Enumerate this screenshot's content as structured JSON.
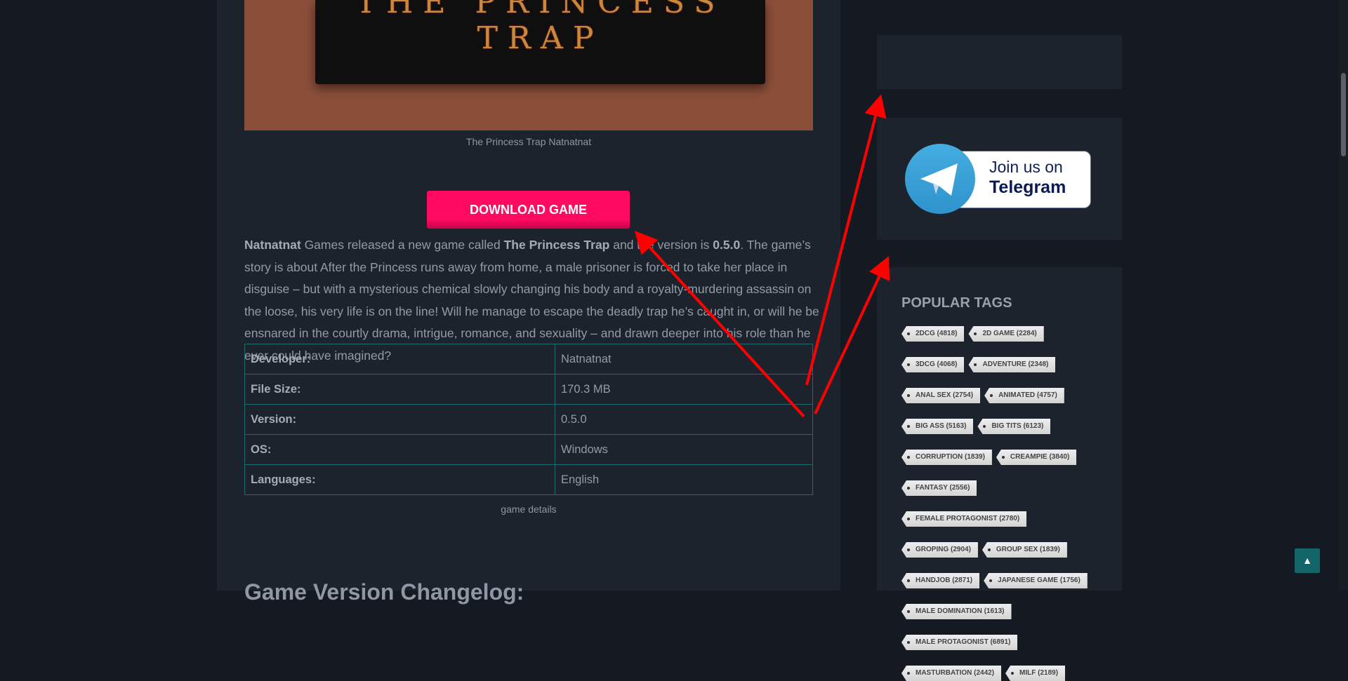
{
  "cover": {
    "title_art": "THE PRINCESS TRAP",
    "caption": "The Princess Trap Natnatnat"
  },
  "download_label": "DOWNLOAD GAME",
  "description": {
    "developer": "Natnatnat",
    "t1": " Games released a new game called ",
    "game": "The Princess Trap",
    "t2": " and the version is ",
    "version": "0.5.0",
    "t3": ". The game’s story is about After the Princess runs away from home, a male prisoner is forced to take her place in disguise – but with a mysterious chemical slowly changing his body and a royalty-murdering assassin on the loose, his very life is on the line! Will he manage to escape the deadly trap he’s caught in, or will he be ensnared in the courtly drama, intrigue, romance, and sexuality – and drawn deeper into his role than he ever could have imagined?"
  },
  "details": [
    {
      "key": "Developer",
      "value": "Natnatnat"
    },
    {
      "key": "File Size",
      "value": "170.3 MB"
    },
    {
      "key": "Version",
      "value": "0.5.0"
    },
    {
      "key": "OS",
      "value": "Windows"
    },
    {
      "key": "Languages",
      "value": "English"
    }
  ],
  "details_caption": "game details",
  "changelog_heading": "Game Version Changelog:",
  "telegram": {
    "line1": "Join us on",
    "line2": "Telegram"
  },
  "popular_tags": {
    "title": "POPULAR TAGS",
    "tags": [
      "2DCG (4818)",
      "2D GAME (2284)",
      "3DCG (4068)",
      "ADVENTURE (2348)",
      "ANAL SEX (2754)",
      "ANIMATED (4757)",
      "BIG ASS (5163)",
      "BIG TITS (6123)",
      "CORRUPTION (1839)",
      "CREAMPIE (3840)",
      "FANTASY (2556)",
      "FEMALE PROTAGONIST (2780)",
      "GROPING (2904)",
      "GROUP SEX (1839)",
      "HANDJOB (2871)",
      "JAPANESE GAME (1756)",
      "MALE DOMINATION (1613)",
      "MALE PROTAGONIST (6891)",
      "MASTURBATION (2442)",
      "MILF (2189)"
    ]
  },
  "colors": {
    "background": "#151a22",
    "card": "#1c232d",
    "download": "#ff0a5e",
    "table_border": "#1c6b6d",
    "annotation_arrow": "#ff0000",
    "back_to_top": "#146569"
  },
  "back_to_top_icon": "rocket-icon"
}
